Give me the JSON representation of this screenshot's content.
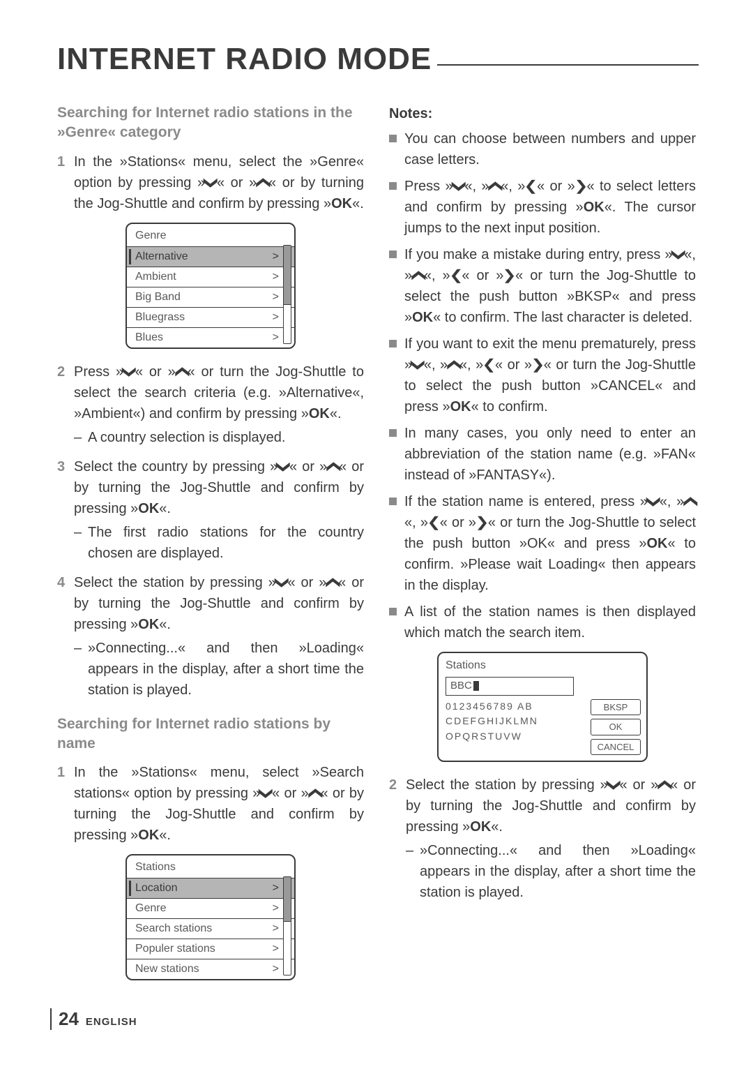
{
  "title": "INTERNET RADIO MODE",
  "left": {
    "heading1": "Searching for Internet radio stations in the »Genre« category",
    "step1": {
      "prefix": "In the »Stations« menu, select the »Genre« option by pressing »",
      "mid1": "« or »",
      "mid2": "« or by turning the Jog-Shuttle and confirm by pressing »",
      "suffix": "«.",
      "ok": "OK"
    },
    "genreMenu": {
      "title": "Genre",
      "items": [
        "Alternative",
        "Ambient",
        "Big Band",
        "Bluegrass",
        "Blues"
      ]
    },
    "step2": {
      "prefix": "Press »",
      "mid1": "« or »",
      "mid2": "« or turn the Jog-Shuttle to select the search criteria (e.g. »Alternative«, »Ambient«) and confirm by pressing »",
      "suffix": "«.",
      "ok": "OK",
      "sub": "A country selection is displayed."
    },
    "step3": {
      "prefix": "Select the country by pressing »",
      "mid1": "« or »",
      "mid2": "« or by turning the Jog-Shuttle and confirm by pressing »",
      "suffix": "«.",
      "ok": "OK",
      "sub": "The first radio stations for the country chosen are displayed."
    },
    "step4": {
      "prefix": "Select the station by pressing »",
      "mid1": "« or »",
      "mid2": "« or by turning the Jog-Shuttle and confirm by pressing »",
      "suffix": "«.",
      "ok": "OK",
      "sub": "»Connecting...« and then »Loading« appears in the display, after a short time the station is played."
    },
    "heading2": "Searching for Internet radio stations by name",
    "step1b": {
      "prefix": "In the »Stations« menu, select »Search stations« option by pressing »",
      "mid1": "« or »",
      "mid2": "« or by turning the Jog-Shuttle and confirm by pressing »",
      "suffix": "«.",
      "ok": "OK"
    },
    "stationsMenu": {
      "title": "Stations",
      "items": [
        "Location",
        "Genre",
        "Search stations",
        "Populer stations",
        "New stations"
      ]
    }
  },
  "right": {
    "notesTitle": "Notes:",
    "b1": "You can choose between numbers and upper case letters.",
    "b2": {
      "prefix": "Press »",
      "sep": "«, »",
      "or": "« or »",
      "mid": "« to select letters and confirm by pressing »",
      "ok": "OK",
      "suffix": "«. The cursor jumps to the next input position."
    },
    "b3": {
      "prefix": "If you make a mistake during entry, press »",
      "sep": "«, »",
      "or": "« or »",
      "mid": "« or turn the Jog-Shuttle to select the push button »BKSP« and press »",
      "ok": "OK",
      "suffix": "« to confirm. The last character is deleted."
    },
    "b4": {
      "prefix": "If you want to exit the menu prematurely, press »",
      "sep": "«, »",
      "or": "« or »",
      "mid": "« or turn the Jog-Shuttle to select the push button »CANCEL« and press »",
      "ok": "OK",
      "suffix": "« to confirm."
    },
    "b5": "In many cases, you only need to enter an abbreviation of the station name (e.g. »FAN« instead of »FANTASY«).",
    "b6": {
      "prefix": "If the station name is entered, press »",
      "sep": "«, »",
      "or": "« or »",
      "mid": "« or turn the Jog-Shuttle to select the push button »OK« and press »",
      "ok": "OK",
      "suffix": "« to confirm. »Please wait Loading« then appears in the display."
    },
    "b7": "A list of the station names is then displayed which match the search item.",
    "searchBox": {
      "title": "Stations",
      "entry": "BBC",
      "row1": "0123456789 AB",
      "row2": "CDEFGHIJKLMN",
      "row3": "OPQRSTUVW",
      "btnBksp": "BKSP",
      "btnOk": "OK",
      "btnCancel": "CANCEL"
    },
    "step2": {
      "num": "2",
      "prefix": "Select the station by pressing »",
      "mid1": "« or »",
      "mid2": "« or by turning the Jog-Shuttle and confirm by pressing »",
      "ok": "OK",
      "suffix": "«.",
      "sub": "»Connecting...« and then »Loading« appears in the display, after a short time the station is played."
    }
  },
  "nums": {
    "n1": "1",
    "n2": "2",
    "n3": "3",
    "n4": "4"
  },
  "glyphs": {
    "down": "❯",
    "up": "❯",
    "left": "❮",
    "right": "❯",
    "gt": ">"
  },
  "footer": {
    "page": "24",
    "lang": "ENGLISH"
  }
}
